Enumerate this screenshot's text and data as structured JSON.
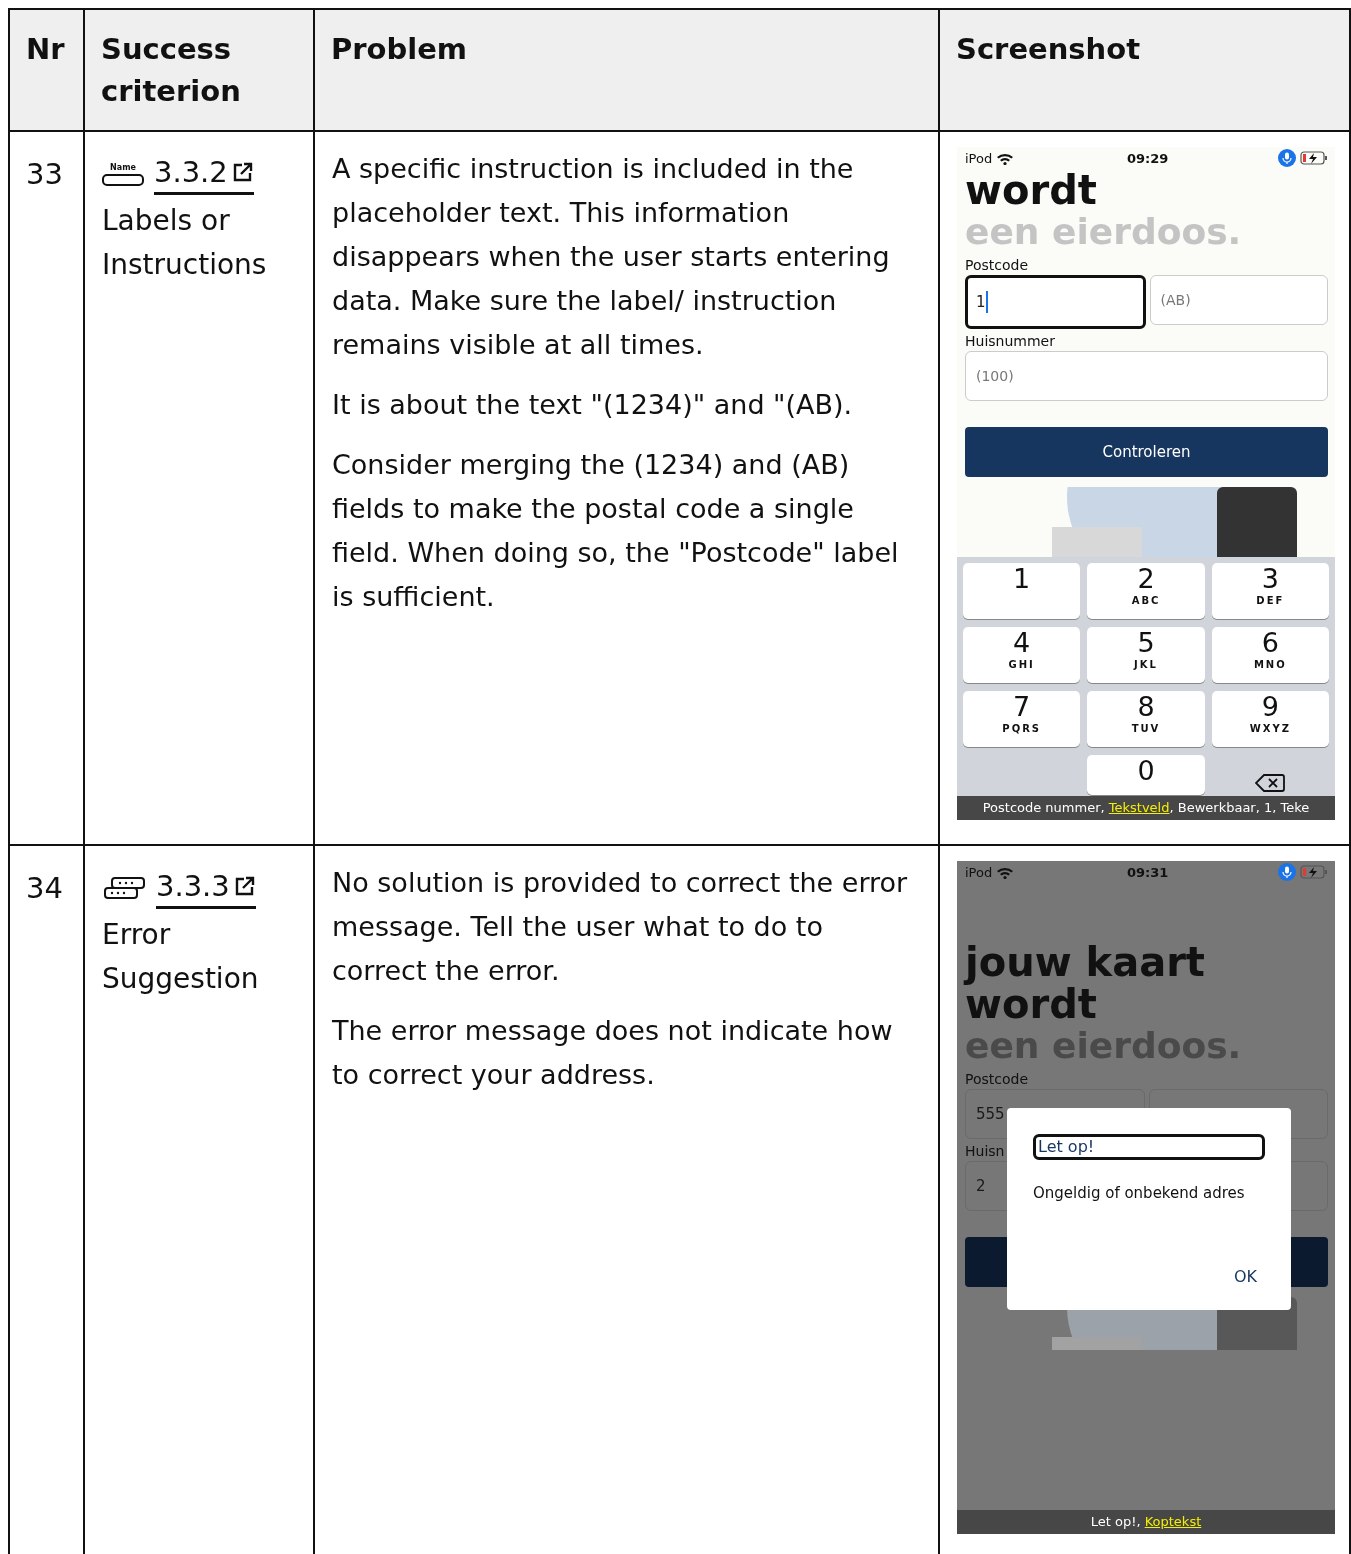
{
  "table": {
    "columns": [
      {
        "label": "Nr"
      },
      {
        "label": "Success criterion"
      },
      {
        "label": "Problem"
      },
      {
        "label": "Screenshot"
      }
    ],
    "rows": [
      {
        "nr": "33",
        "criterion": {
          "kind": "form-field",
          "icon_text": "Name",
          "link": "3.3.2",
          "name": "Labels or Instructions"
        },
        "problem": [
          "A specific instruction is included in the placeholder text. This information disappears when the user starts entering data. Make sure the label/ instruction remains visible at all times.",
          "It is about the text \"(1234)\" and \"(AB).",
          "Consider merging the (1234) and (AB) fields to make the postal code a single field. When doing so, the \"Postcode\" label is sufficient."
        ],
        "screenshot": {
          "status": {
            "carrier": "iPod",
            "time": "09:29"
          },
          "heading": [
            "wordt"
          ],
          "subheading": "een eierdoos.",
          "postcode_label": "Postcode",
          "postcode_fields": [
            {
              "value": "1",
              "focused": true
            },
            {
              "placeholder": "(AB)",
              "focused": false
            }
          ],
          "house_label": "Huisnummer",
          "house_field": {
            "placeholder": "(100)",
            "focused": false
          },
          "button": {
            "label": "Controleren"
          },
          "keypad": [
            {
              "kind": "digit",
              "digit": "1"
            },
            {
              "kind": "digit",
              "digit": "2",
              "letters": "ABC"
            },
            {
              "kind": "digit",
              "digit": "3",
              "letters": "DEF"
            },
            {
              "kind": "digit",
              "digit": "4",
              "letters": "GHI"
            },
            {
              "kind": "digit",
              "digit": "5",
              "letters": "JKL"
            },
            {
              "kind": "digit",
              "digit": "6",
              "letters": "MNO"
            },
            {
              "kind": "digit",
              "digit": "7",
              "letters": "PQRS"
            },
            {
              "kind": "digit",
              "digit": "8",
              "letters": "TUV"
            },
            {
              "kind": "digit",
              "digit": "9",
              "letters": "WXYZ"
            },
            {
              "kind": "blank"
            },
            {
              "kind": "digit",
              "digit": "0"
            },
            {
              "kind": "delete"
            }
          ],
          "dimmed": false,
          "voiceover": [
            {
              "kind": "plain",
              "text": "Postcode nummer, "
            },
            {
              "kind": "role",
              "text": "Tekstveld"
            },
            {
              "kind": "plain",
              "text": ", Bewerkbaar, 1, Teke"
            }
          ]
        }
      },
      {
        "nr": "34",
        "criterion": {
          "kind": "chat",
          "link": "3.3.3",
          "name": "Error Suggestion"
        },
        "problem": [
          "No solution is provided to correct the error message. Tell the user what to do to correct the error.",
          "The error message does not indicate how to correct your address."
        ],
        "screenshot": {
          "status": {
            "carrier": "iPod",
            "time": "09:31"
          },
          "heading": [
            "jouw kaart",
            "wordt"
          ],
          "subheading": "een eierdoos.",
          "postcode_label": "Postcode",
          "postcode_fields": [
            {
              "value": "555",
              "focused": false
            },
            {
              "focused": false
            }
          ],
          "house_label": "Huisn",
          "house_field": {
            "value": "2",
            "focused": false
          },
          "dialog": {
            "title": "Let op!",
            "message": "Ongeldig of onbekend adres",
            "button": "OK"
          },
          "dimmed": true,
          "voiceover": [
            {
              "kind": "plain",
              "text": "Let op!, "
            },
            {
              "kind": "role",
              "text": "Koptekst"
            }
          ]
        }
      }
    ]
  }
}
